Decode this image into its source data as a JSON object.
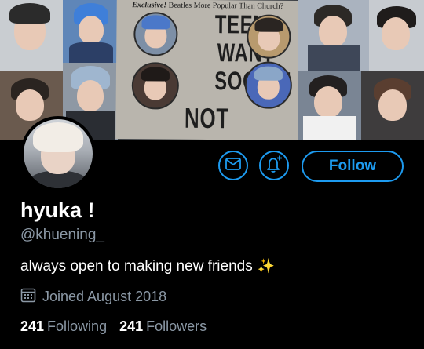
{
  "banner": {
    "poster_small": "Exclusive! Beatles More Popular Than Church?",
    "poster_small_emph": "Exclusive!",
    "poster_small_rest": "Beatles More Popular Than Church?",
    "headline_1": "TEENS",
    "headline_2": "WANT",
    "headline_3": "SOOBIN",
    "headline_4": "NOT JESUS!"
  },
  "actions": {
    "mail_icon": "mail-icon",
    "notify_icon": "bell-plus-icon",
    "follow_label": "Follow"
  },
  "profile": {
    "display_name": "hyuka !",
    "handle": "@khuening_",
    "bio": "always open to making new friends",
    "bio_emoji": "✨",
    "joined_icon": "calendar-icon",
    "joined": "Joined August 2018"
  },
  "stats": {
    "following_count": "241",
    "following_label": "Following",
    "followers_count": "241",
    "followers_label": "Followers"
  },
  "colors": {
    "accent": "#1d9bf0",
    "background": "#000000",
    "muted": "#8b98a5"
  }
}
